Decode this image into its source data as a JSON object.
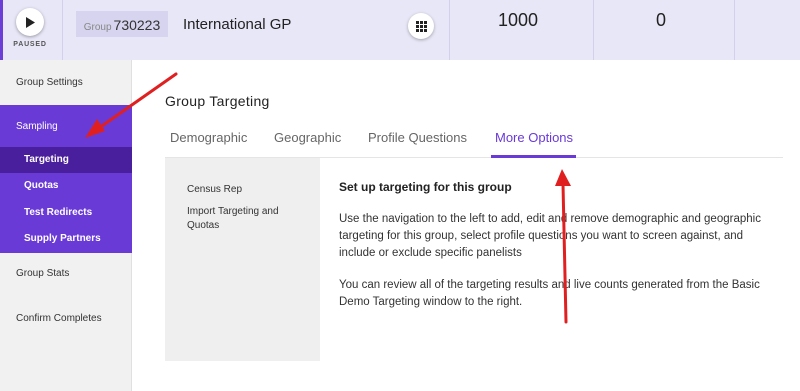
{
  "header": {
    "play_status": "PAUSED",
    "group_prefix": "Group",
    "group_id": "730223",
    "group_name": "International GP",
    "stat_1": "1000",
    "stat_2": "0"
  },
  "sidebar": {
    "group_settings": "Group Settings",
    "sampling": "Sampling",
    "sub_items": [
      "Targeting",
      "Quotas",
      "Test Redirects",
      "Supply Partners"
    ],
    "group_stats": "Group Stats",
    "confirm_completes": "Confirm Completes"
  },
  "main": {
    "title": "Group Targeting",
    "tabs": [
      "Demographic",
      "Geographic",
      "Profile Questions",
      "More Options"
    ],
    "active_tab": "More Options",
    "left_links": [
      "Census Rep",
      "Import Targeting and Quotas"
    ],
    "content_title": "Set up targeting for this group",
    "paragraph_1": "Use the navigation to the left to add, edit and remove demographic and geographic targeting for this group, select profile questions you want to screen against, and include or exclude specific panelists",
    "paragraph_2": "You can review all of the targeting results and live counts generated from the Basic Demo Targeting window to the right."
  },
  "colors": {
    "accent": "#6a3ad6",
    "accent_dark": "#4a1f9e",
    "header_bg": "#e8e7f7",
    "arrow": "#e02020"
  },
  "icons": {
    "play": "play-icon",
    "grid": "grid-icon"
  }
}
